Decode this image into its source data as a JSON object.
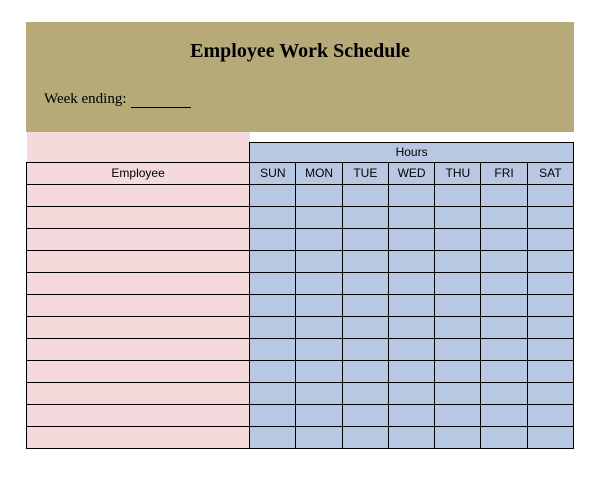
{
  "header": {
    "title": "Employee Work Schedule",
    "weekEndingLabel": "Week ending:",
    "weekEndingValue": ""
  },
  "table": {
    "employeeHeader": "Employee",
    "hoursHeader": "Hours",
    "days": [
      "SUN",
      "MON",
      "TUE",
      "WED",
      "THU",
      "FRI",
      "SAT"
    ],
    "rows": [
      {
        "employee": "",
        "hours": [
          "",
          "",
          "",
          "",
          "",
          "",
          ""
        ]
      },
      {
        "employee": "",
        "hours": [
          "",
          "",
          "",
          "",
          "",
          "",
          ""
        ]
      },
      {
        "employee": "",
        "hours": [
          "",
          "",
          "",
          "",
          "",
          "",
          ""
        ]
      },
      {
        "employee": "",
        "hours": [
          "",
          "",
          "",
          "",
          "",
          "",
          ""
        ]
      },
      {
        "employee": "",
        "hours": [
          "",
          "",
          "",
          "",
          "",
          "",
          ""
        ]
      },
      {
        "employee": "",
        "hours": [
          "",
          "",
          "",
          "",
          "",
          "",
          ""
        ]
      },
      {
        "employee": "",
        "hours": [
          "",
          "",
          "",
          "",
          "",
          "",
          ""
        ]
      },
      {
        "employee": "",
        "hours": [
          "",
          "",
          "",
          "",
          "",
          "",
          ""
        ]
      },
      {
        "employee": "",
        "hours": [
          "",
          "",
          "",
          "",
          "",
          "",
          ""
        ]
      },
      {
        "employee": "",
        "hours": [
          "",
          "",
          "",
          "",
          "",
          "",
          ""
        ]
      },
      {
        "employee": "",
        "hours": [
          "",
          "",
          "",
          "",
          "",
          "",
          ""
        ]
      },
      {
        "employee": "",
        "hours": [
          "",
          "",
          "",
          "",
          "",
          "",
          ""
        ]
      }
    ]
  }
}
